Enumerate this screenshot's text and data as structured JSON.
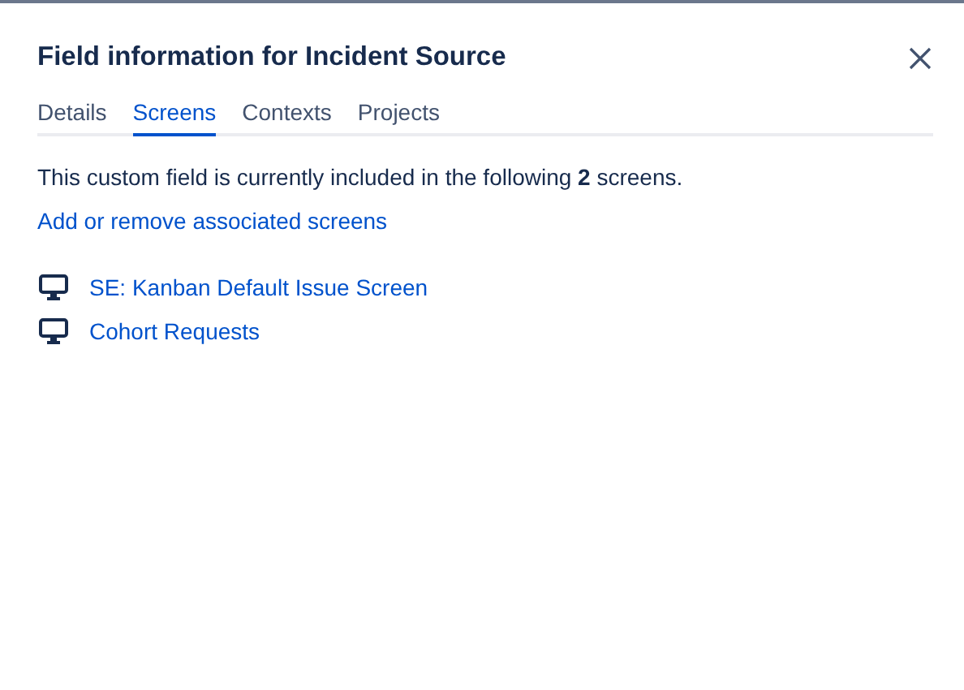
{
  "dialog": {
    "title": "Field information for Incident Source"
  },
  "tabs": [
    {
      "label": "Details",
      "selected": false
    },
    {
      "label": "Screens",
      "selected": true
    },
    {
      "label": "Contexts",
      "selected": false
    },
    {
      "label": "Projects",
      "selected": false
    }
  ],
  "description": "This custom field is currently included in the following **2** screens.",
  "manage_link": "Add or remove associated screens",
  "screens": [
    "SE: Kanban Default Issue Screen",
    "Cohort Requests"
  ]
}
